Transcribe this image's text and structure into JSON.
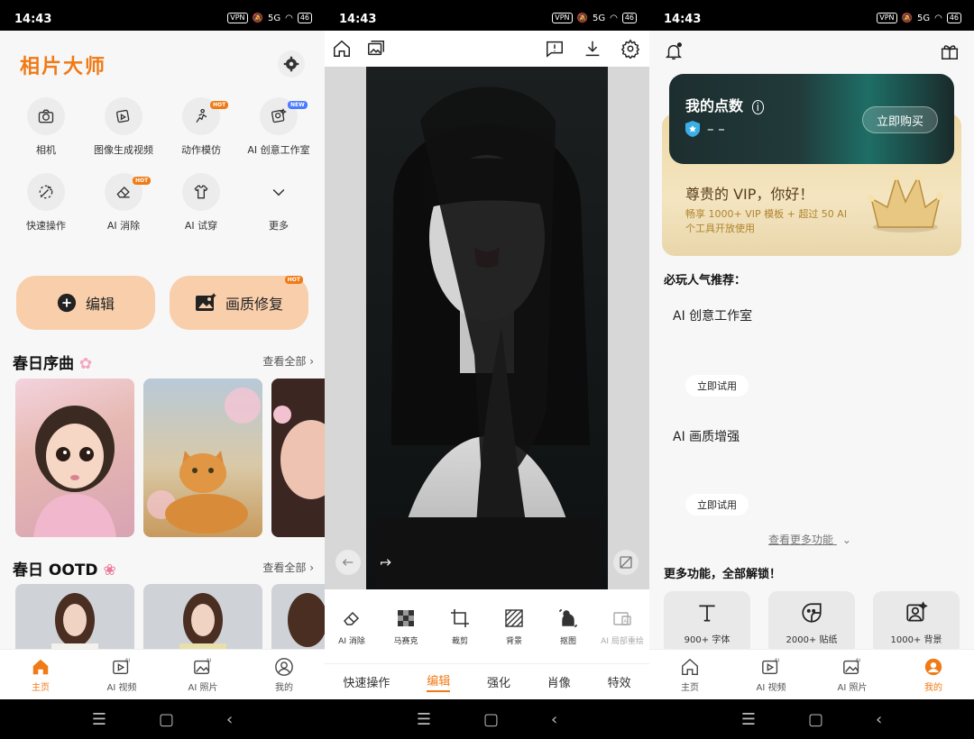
{
  "status": {
    "time": "14:43",
    "vpn": "VPN",
    "net": "5G",
    "battery": "46"
  },
  "home": {
    "title": "相片大师",
    "features": [
      {
        "label": "相机",
        "icon": "camera-icon",
        "tag": ""
      },
      {
        "label": "图像生成视频",
        "icon": "image-to-video-icon",
        "tag": ""
      },
      {
        "label": "动作模仿",
        "icon": "motion-icon",
        "tag": "HOT"
      },
      {
        "label": "AI 创意工作室",
        "icon": "ai-studio-icon",
        "tag": "NEW"
      },
      {
        "label": "快速操作",
        "icon": "magic-wand-icon",
        "tag": ""
      },
      {
        "label": "AI 消除",
        "icon": "eraser-icon",
        "tag": "HOT"
      },
      {
        "label": "AI 试穿",
        "icon": "tryon-icon",
        "tag": ""
      },
      {
        "label": "更多",
        "icon": "chevron-down-icon",
        "tag": ""
      }
    ],
    "edit_label": "编辑",
    "enhance_label": "画质修复",
    "enhance_tag": "HOT",
    "section1_title": "春日序曲",
    "section2_title": "春日 OOTD",
    "see_all": "查看全部"
  },
  "tabs_home": [
    {
      "label": "主页"
    },
    {
      "label": "AI 视频"
    },
    {
      "label": "AI 照片"
    },
    {
      "label": "我的"
    }
  ],
  "editor": {
    "tools": [
      {
        "label": "AI 消除"
      },
      {
        "label": "马赛克"
      },
      {
        "label": "裁剪"
      },
      {
        "label": "背景"
      },
      {
        "label": "抠图"
      },
      {
        "label": "AI 局部重绘"
      }
    ],
    "modes": [
      {
        "label": "快速操作"
      },
      {
        "label": "编辑"
      },
      {
        "label": "强化"
      },
      {
        "label": "肖像"
      },
      {
        "label": "特效"
      }
    ]
  },
  "profile": {
    "points_title": "我的点数",
    "points_value": "– –",
    "buy_label": "立即购买",
    "vip_title": "尊贵的 VIP，你好！",
    "vip_desc1": "畅享 1000+ VIP 模板 + 超过 50 AI",
    "vip_desc2": "个工具开放使用",
    "recommend_title": "必玩人气推荐：",
    "rec1_title": "AI 创意工作室",
    "rec2_title": "AI 画质增强",
    "try_label": "立即试用",
    "more_features_link": "查看更多功能",
    "unlock_title": "更多功能，全部解锁！",
    "cards": [
      {
        "label": "900+ 字体"
      },
      {
        "label": "2000+ 贴纸"
      },
      {
        "label": "1000+ 背景"
      }
    ]
  },
  "colors": {
    "accent": "#f07a16",
    "button_peach": "#f9ceab",
    "hot": "#f07a16",
    "new": "#4a7bff"
  }
}
